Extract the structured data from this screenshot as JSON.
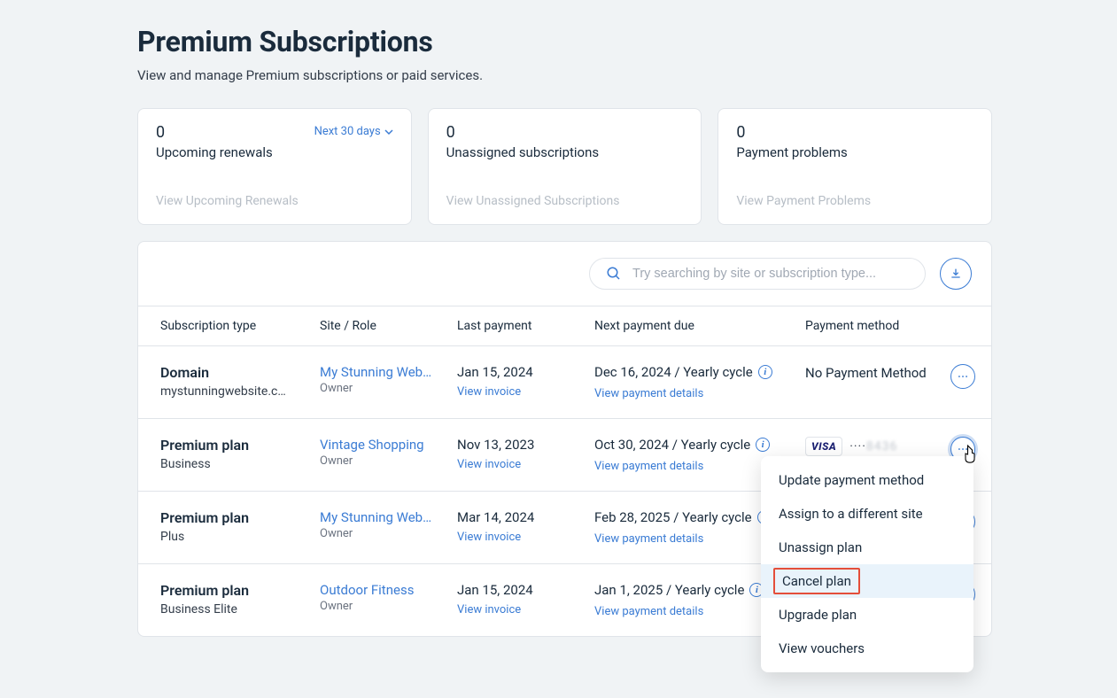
{
  "header": {
    "title": "Premium Subscriptions",
    "subtitle": "View and manage Premium subscriptions or paid services."
  },
  "summary_cards": [
    {
      "count": "0",
      "label": "Upcoming renewals",
      "link_text": "View Upcoming Renewals",
      "filter_label": "Next 30 days",
      "has_filter": true
    },
    {
      "count": "0",
      "label": "Unassigned subscriptions",
      "link_text": "View Unassigned Subscriptions",
      "has_filter": false
    },
    {
      "count": "0",
      "label": "Payment problems",
      "link_text": "View Payment Problems",
      "has_filter": false
    }
  ],
  "search": {
    "placeholder": "Try searching by site or subscription type..."
  },
  "columns": {
    "c0": "Subscription type",
    "c1": "Site / Role",
    "c2": "Last payment",
    "c3": "Next payment due",
    "c4": "Payment method"
  },
  "shared": {
    "view_invoice": "View invoice",
    "view_payment_details": "View payment details"
  },
  "rows": [
    {
      "type": "Domain",
      "subtype": "mystunningwebsite.c…",
      "site": "My Stunning Web…",
      "role": "Owner",
      "last_payment": "Jan 15, 2024",
      "next_payment": "Dec 16, 2024 / Yearly cycle",
      "payment_method": {
        "kind": "none",
        "text": "No Payment Method"
      },
      "menu_open": false
    },
    {
      "type": "Premium plan",
      "subtype": "Business",
      "site": "Vintage Shopping",
      "role": "Owner",
      "last_payment": "Nov 13, 2023",
      "next_payment": "Oct 30, 2024 / Yearly cycle",
      "payment_method": {
        "kind": "visa",
        "brand": "VISA",
        "dots": "····",
        "masked": "8436"
      },
      "menu_open": true
    },
    {
      "type": "Premium plan",
      "subtype": "Plus",
      "site": "My Stunning Web…",
      "role": "Owner",
      "last_payment": "Mar 14, 2024",
      "next_payment": "Feb 28, 2025 / Yearly cycle",
      "payment_method": {
        "kind": "hidden"
      },
      "menu_open": false
    },
    {
      "type": "Premium plan",
      "subtype": "Business Elite",
      "site": "Outdoor Fitness",
      "role": "Owner",
      "last_payment": "Jan 15, 2024",
      "next_payment": "Jan 1, 2025 / Yearly cycle",
      "payment_method": {
        "kind": "hidden"
      },
      "menu_open": false
    }
  ],
  "dropdown": {
    "items": [
      {
        "label": "Update payment method",
        "highlight": false
      },
      {
        "label": "Assign to a different site",
        "highlight": false
      },
      {
        "label": "Unassign plan",
        "highlight": false
      },
      {
        "label": "Cancel plan",
        "highlight": true
      },
      {
        "label": "Upgrade plan",
        "highlight": false
      },
      {
        "label": "View vouchers",
        "highlight": false
      }
    ]
  }
}
